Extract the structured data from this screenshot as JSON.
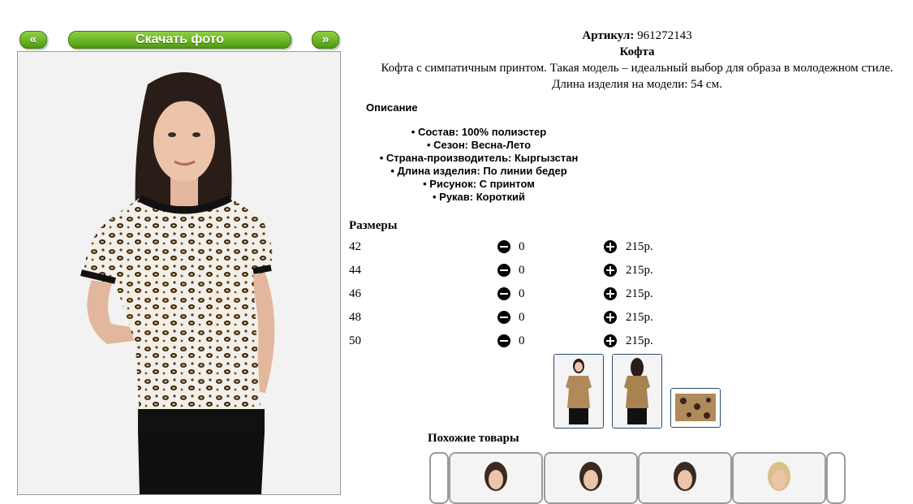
{
  "nav": {
    "prev_label": "«",
    "download_label": "Скачать фото",
    "next_label": "»"
  },
  "product": {
    "article_label": "Артикул:",
    "article_value": "961272143",
    "name": "Кофта",
    "description": "Кофта с симпатичным принтом. Такая модель – идеальный выбор для образа в молодежном стиле.",
    "length_note": "Длина изделия на модели: 54 см."
  },
  "description_section": {
    "title": "Описание",
    "features": [
      "• Состав: 100% полиэстер",
      "• Сезон: Весна-Лето",
      "• Страна-производитель: Кыргызстан",
      "• Длина изделия: По линии бедер",
      "• Рисунок: С принтом",
      "• Рукав: Короткий"
    ]
  },
  "sizes": {
    "title": "Размеры",
    "rows": [
      {
        "size": "42",
        "qty": "0",
        "price": "215р."
      },
      {
        "size": "44",
        "qty": "0",
        "price": "215р."
      },
      {
        "size": "46",
        "qty": "0",
        "price": "215р."
      },
      {
        "size": "48",
        "qty": "0",
        "price": "215р."
      },
      {
        "size": "50",
        "qty": "0",
        "price": "215р."
      }
    ]
  },
  "similar": {
    "title": "Похожие товары"
  },
  "colors": {
    "button_green": "#5aa81a",
    "thumb_border": "#2b4a6b"
  }
}
